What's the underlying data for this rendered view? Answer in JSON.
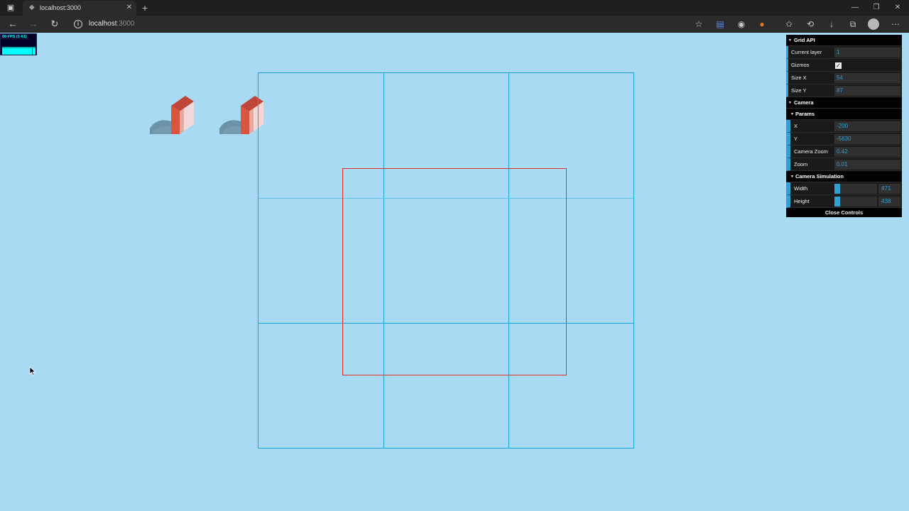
{
  "browser": {
    "tab_title": "localhost:3000",
    "url_host": "localhost",
    "url_port": ":3000"
  },
  "fps": {
    "label": "60 FPS (0-61)"
  },
  "gui": {
    "grid_api": {
      "title": "Grid API",
      "current_layer_label": "Current layer",
      "current_layer_value": "1",
      "gizmos_label": "Gizmos",
      "gizmos_checked": true,
      "size_x_label": "Size X",
      "size_x_value": "54",
      "size_y_label": "Size Y",
      "size_y_value": "87"
    },
    "camera": {
      "title": "Camera",
      "params": {
        "title": "Params",
        "x_label": "X",
        "x_value": "-200",
        "y_label": "Y",
        "y_value": "-5630",
        "camera_zoom_label": "Camera Zoom",
        "camera_zoom_value": "0.42",
        "zoom_label": "Zoom",
        "zoom_value": "0.01"
      },
      "simulation": {
        "title": "Camera Simulation",
        "width_label": "Width",
        "width_value": "471",
        "width_fraction": 0.14,
        "height_label": "Height",
        "height_value": "438",
        "height_fraction": 0.14
      }
    },
    "close_label": "Close Controls"
  },
  "colors": {
    "background": "#a8dbf3",
    "grid_line": "#1aa3d9",
    "camera_rect": "#e0302b",
    "gui_accent": "#2fa1d6"
  }
}
